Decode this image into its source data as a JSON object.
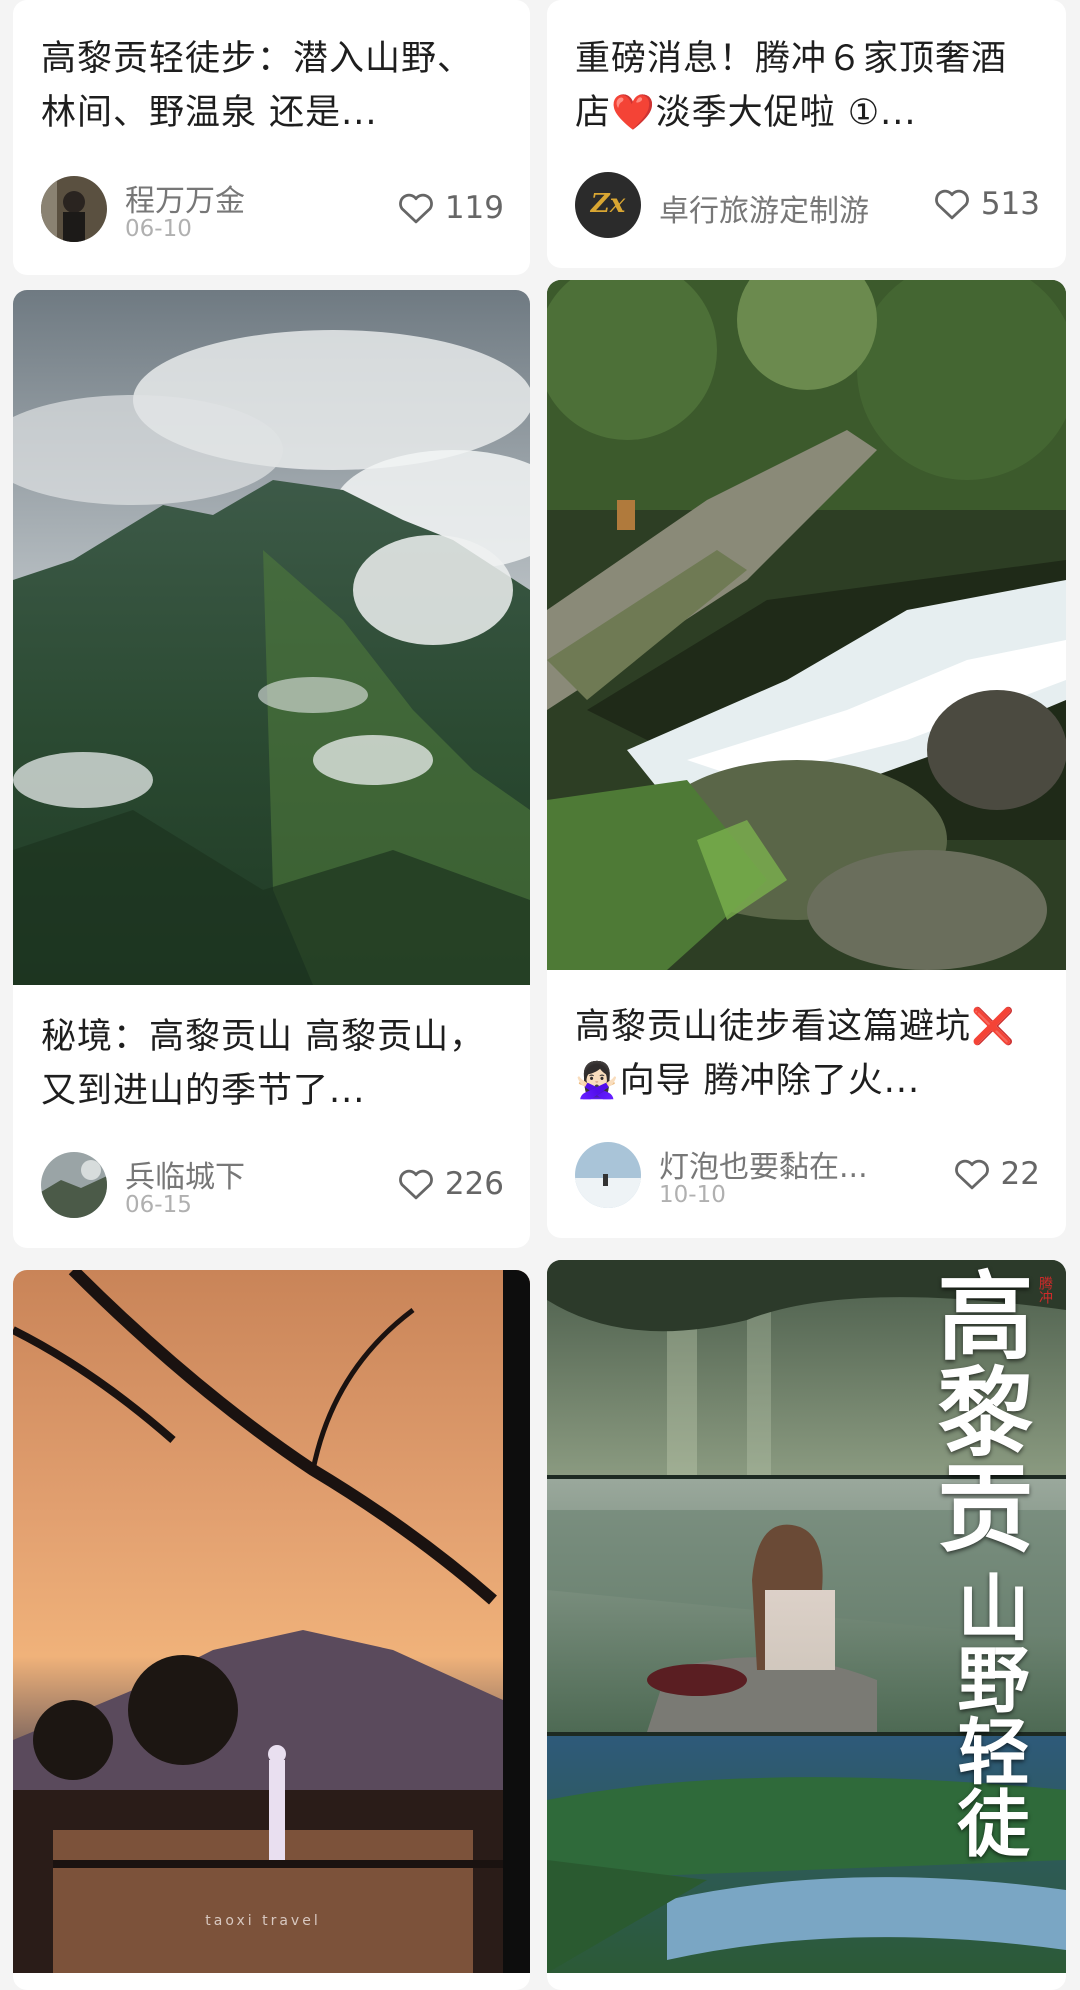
{
  "cards": {
    "c1": {
      "title": "高黎贡轻徒步：潜入山野、林间、野温泉 还是...",
      "author": "程万万金",
      "date": "06-10",
      "likes": "119"
    },
    "c2": {
      "title": "重磅消息！腾冲６家顶奢酒店❤️淡季大促啦 ①...",
      "author": "卓行旅游定制游",
      "likes": "513",
      "avatar_text": "Zx"
    },
    "c3": {
      "title": "秘境：高黎贡山 高黎贡山，又到进山的季节了...",
      "author": "兵临城下",
      "date": "06-15",
      "likes": "226"
    },
    "c4": {
      "title": "高黎贡山徒步看这篇避坑❌🙅🏻‍♀️向导 腾冲除了火...",
      "author": "灯泡也要黏在...",
      "date": "10-10",
      "likes": "22"
    },
    "c5": {
      "watermark": "taoxi travel"
    },
    "c6": {
      "cover_text_1": "高黎贡",
      "cover_text_2": "山野轻徒",
      "seal": "腾冲"
    }
  },
  "colors": {
    "like_icon": "#666666",
    "background": "#f4f4f4",
    "card": "#ffffff"
  },
  "icons": {
    "like": "heart-outline-icon"
  }
}
